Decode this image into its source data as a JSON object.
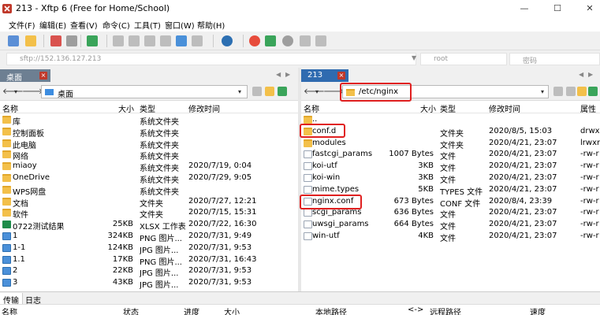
{
  "window": {
    "title": "213 - Xftp 6 (Free for Home/School)",
    "minimize": "—",
    "maximize": "☐",
    "close": "✕"
  },
  "menu": [
    "文件(F)",
    "编辑(E)",
    "查看(V)",
    "命令(C)",
    "工具(T)",
    "窗口(W)",
    "帮助(H)"
  ],
  "address": {
    "host_placeholder": "sftp://152.136.127.213",
    "user_placeholder": "root",
    "password_placeholder": "密码"
  },
  "left": {
    "tab_label": "桌面",
    "tab_close": "×",
    "path": "桌面",
    "columns": {
      "name": "名称",
      "size": "大小",
      "type": "类型",
      "modified": "修改时间"
    },
    "rows": [
      {
        "name": "库",
        "size": "",
        "type": "系统文件夹",
        "modified": "",
        "icon": "folder"
      },
      {
        "name": "控制面板",
        "size": "",
        "type": "系统文件夹",
        "modified": "",
        "icon": "folder"
      },
      {
        "name": "此电脑",
        "size": "",
        "type": "系统文件夹",
        "modified": "",
        "icon": "folder"
      },
      {
        "name": "网络",
        "size": "",
        "type": "系统文件夹",
        "modified": "",
        "icon": "folder"
      },
      {
        "name": "miaoy",
        "size": "",
        "type": "系统文件夹",
        "modified": "2020/7/19, 0:04",
        "icon": "folder"
      },
      {
        "name": "OneDrive",
        "size": "",
        "type": "系统文件夹",
        "modified": "2020/7/29, 9:05",
        "icon": "folder"
      },
      {
        "name": "WPS网盘",
        "size": "",
        "type": "系统文件夹",
        "modified": "",
        "icon": "folder"
      },
      {
        "name": "文档",
        "size": "",
        "type": "文件夹",
        "modified": "2020/7/27, 12:21",
        "icon": "folder"
      },
      {
        "name": "软件",
        "size": "",
        "type": "文件夹",
        "modified": "2020/7/15, 15:31",
        "icon": "folder"
      },
      {
        "name": "0722测试结果",
        "size": "25KB",
        "type": "XLSX 工作表",
        "modified": "2020/7/22, 16:30",
        "icon": "xls"
      },
      {
        "name": "1",
        "size": "324KB",
        "type": "PNG 图片...",
        "modified": "2020/7/31, 9:49",
        "icon": "img"
      },
      {
        "name": "1-1",
        "size": "124KB",
        "type": "JPG 图片...",
        "modified": "2020/7/31, 9:53",
        "icon": "img"
      },
      {
        "name": "1.1",
        "size": "17KB",
        "type": "PNG 图片...",
        "modified": "2020/7/31, 16:43",
        "icon": "img"
      },
      {
        "name": "2",
        "size": "22KB",
        "type": "JPG 图片...",
        "modified": "2020/7/31, 9:53",
        "icon": "img"
      },
      {
        "name": "3",
        "size": "43KB",
        "type": "JPG 图片...",
        "modified": "2020/7/31, 9:53",
        "icon": "img"
      }
    ]
  },
  "right": {
    "tab_label": "213",
    "tab_close": "×",
    "path": "/etc/nginx",
    "columns": {
      "name": "名称",
      "size": "大小",
      "type": "类型",
      "modified": "修改时间",
      "attrs": "属性"
    },
    "rows": [
      {
        "name": "..",
        "size": "",
        "type": "",
        "modified": "",
        "attrs": "",
        "icon": "folder"
      },
      {
        "name": "conf.d",
        "size": "",
        "type": "文件夹",
        "modified": "2020/8/5, 15:03",
        "attrs": "drwxr",
        "icon": "folder"
      },
      {
        "name": "modules",
        "size": "",
        "type": "文件夹",
        "modified": "2020/4/21, 23:07",
        "attrs": "lrwxr",
        "icon": "folder"
      },
      {
        "name": "fastcgi_params",
        "size": "1007 Bytes",
        "type": "文件",
        "modified": "2020/4/21, 23:07",
        "attrs": "-rw-r",
        "icon": "file"
      },
      {
        "name": "koi-utf",
        "size": "3KB",
        "type": "文件",
        "modified": "2020/4/21, 23:07",
        "attrs": "-rw-r",
        "icon": "file"
      },
      {
        "name": "koi-win",
        "size": "3KB",
        "type": "文件",
        "modified": "2020/4/21, 23:07",
        "attrs": "-rw-r",
        "icon": "file"
      },
      {
        "name": "mime.types",
        "size": "5KB",
        "type": "TYPES 文件",
        "modified": "2020/4/21, 23:07",
        "attrs": "-rw-r",
        "icon": "file"
      },
      {
        "name": "nginx.conf",
        "size": "673 Bytes",
        "type": "CONF 文件",
        "modified": "2020/8/4, 23:39",
        "attrs": "-rw-r",
        "icon": "file"
      },
      {
        "name": "scgi_params",
        "size": "636 Bytes",
        "type": "文件",
        "modified": "2020/4/21, 23:07",
        "attrs": "-rw-r",
        "icon": "file"
      },
      {
        "name": "uwsgi_params",
        "size": "664 Bytes",
        "type": "文件",
        "modified": "2020/4/21, 23:07",
        "attrs": "-rw-r",
        "icon": "file"
      },
      {
        "name": "win-utf",
        "size": "4KB",
        "type": "文件",
        "modified": "2020/4/21, 23:07",
        "attrs": "-rw-r",
        "icon": "file"
      }
    ]
  },
  "bottom_tabs": [
    "传输",
    "日志"
  ],
  "transfer_columns": [
    "名称",
    "状态",
    "进度",
    "大小",
    "本地路径",
    "<->",
    "远程路径",
    "速度"
  ],
  "colors": {
    "accent_tab": "#2f6bb0",
    "left_tab": "#6d7f92",
    "highlight": "#e02020"
  }
}
